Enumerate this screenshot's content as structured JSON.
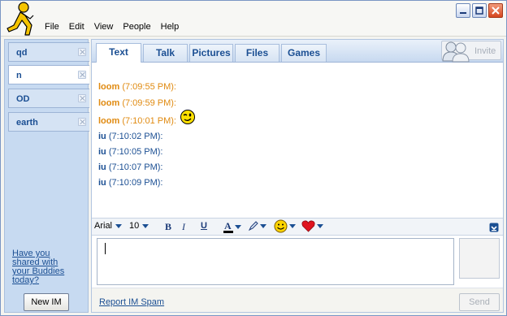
{
  "window": {
    "menu": [
      "File",
      "Edit",
      "View",
      "People",
      "Help"
    ],
    "controls": [
      "minimize-icon",
      "maximize-icon",
      "close-icon"
    ]
  },
  "sidebar": {
    "tabs": [
      {
        "label": "qd",
        "active": false
      },
      {
        "label": "n",
        "active": true
      },
      {
        "label": "OD",
        "active": false
      },
      {
        "label": "earth",
        "active": false
      }
    ],
    "share_link": "Have you shared with your Buddies today?",
    "new_im_label": "New IM"
  },
  "main": {
    "tabs": [
      "Text",
      "Talk",
      "Pictures",
      "Files",
      "Games"
    ],
    "active_tab": "Text",
    "invite_label": "Invite"
  },
  "messages": [
    {
      "name": "loom",
      "time": "(7:09:55 PM):",
      "text": "",
      "emoticon": false,
      "color": "#e08a10"
    },
    {
      "name": "loom",
      "time": "(7:09:59 PM):",
      "text": "",
      "emoticon": false,
      "color": "#e08a10"
    },
    {
      "name": "loom",
      "time": "(7:10:01 PM):",
      "text": "",
      "emoticon": true,
      "color": "#e08a10"
    },
    {
      "name": "iu",
      "time": "(7:10:02 PM):",
      "text": "",
      "emoticon": false,
      "color": "#1b4f93"
    },
    {
      "name": "iu",
      "time": "(7:10:05 PM):",
      "text": "",
      "emoticon": false,
      "color": "#1b4f93"
    },
    {
      "name": "iu",
      "time": "(7:10:07 PM):",
      "text": "",
      "emoticon": false,
      "color": "#1b4f93"
    },
    {
      "name": "iu",
      "time": "(7:10:09 PM):",
      "text": "",
      "emoticon": false,
      "color": "#1b4f93"
    }
  ],
  "format_toolbar": {
    "font": "Arial",
    "size": "10",
    "bold": "B",
    "italic": "I",
    "underline": "U"
  },
  "compose": {
    "value": ""
  },
  "footer": {
    "report_spam": "Report IM Spam",
    "send_label": "Send"
  }
}
